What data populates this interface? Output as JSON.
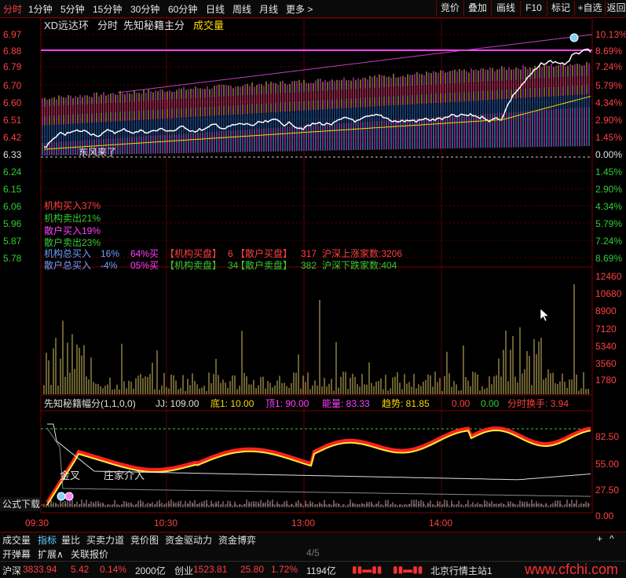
{
  "toolbar": {
    "periods": [
      "分时",
      "1分钟",
      "5分钟",
      "15分钟",
      "30分钟",
      "60分钟",
      "日线",
      "周线",
      "月线",
      "更多 >"
    ],
    "buttons": [
      "竞价",
      "叠加",
      "画线",
      "F10",
      "标记",
      "+自选",
      "返回"
    ]
  },
  "main_chart": {
    "title_stock": "XD远达环",
    "title_mode": "分时",
    "title_indicator": "先知秘籍主分",
    "title_volume": "成交量",
    "price_ticks": [
      "6.97",
      "6.88",
      "6.79",
      "6.70",
      "6.60",
      "6.51",
      "6.42",
      "6.33",
      "6.24",
      "6.15",
      "6.06",
      "5.96",
      "5.87",
      "5.78"
    ],
    "pct_ticks": [
      "10.13%",
      "8.69%",
      "7.24%",
      "5.79%",
      "4.34%",
      "2.90%",
      "1.45%",
      "0.00%",
      "1.45%",
      "2.90%",
      "4.34%",
      "5.79%",
      "7.24%",
      "8.69%"
    ],
    "inst_buy": "机构买入37%",
    "inst_sell": "机构卖出21%",
    "retail_buy": "散户买入19%",
    "retail_sell": "散户卖出23%",
    "row1_a": "机构总买入",
    "row1_b": "16%",
    "row1_c": "64%买",
    "row1_d": "【机构买盘】",
    "row1_e": "6",
    "row1_f": "【散户买盘】",
    "row1_g": "317",
    "row1_h": "沪深上涨家数:3206",
    "row2_a": "散户总买入",
    "row2_b": "-4%",
    "row2_c": "05%买",
    "row2_d": "【机构卖盘】",
    "row2_e": "34",
    "row2_f": "【散户卖盘】",
    "row2_g": "382",
    "row2_h": "沪深下跌家数:404",
    "marker_label": "东风来了"
  },
  "volume_chart": {
    "ticks": [
      "12460",
      "10680",
      "8900",
      "7120",
      "5340",
      "3560",
      "1780"
    ]
  },
  "indicator": {
    "name": "先知秘籍幅分(1,1,0,0)",
    "jj": "JJ: 109.00",
    "di": "底1: 10.00",
    "ding": "顶1: 90.00",
    "energy": "能量: 83.33",
    "trend": "趋势: 81.85",
    "v1": "0.00",
    "v2": "0.00",
    "turnover": "分时换手: 3.94",
    "ticks": [
      "82.50",
      "55.00",
      "27.50",
      "0.00"
    ],
    "label_jincha": "金叉",
    "label_zhuang": "庄家介入",
    "formula_btn": "公式下载"
  },
  "time_axis": [
    "09:30",
    "10:30",
    "13:00",
    "14:00"
  ],
  "bottom_tabs": [
    "成交量",
    "指标",
    "量比",
    "买卖力道",
    "竞价图",
    "资金驱动力",
    "资金博弈"
  ],
  "bottom_tabs2": [
    "开弹幕",
    "扩展∧",
    "关联报价"
  ],
  "pager": "4/5",
  "status": {
    "sh_name": "沪深",
    "sh_val": "3833.94",
    "sh_chg": "5.42",
    "sh_pct": "0.14%",
    "sh_amt": "2000亿",
    "cy_name": "创业",
    "cy_val": "1523.81",
    "cy_chg": "25.80",
    "cy_pct": "1.72%",
    "cy_amt": "1194亿",
    "station": "北京行情主站1",
    "watermark": "www.cfchi.com"
  },
  "colors": {
    "up": "#ff4040",
    "down": "#33cc33",
    "grid": "#7a0000",
    "bg": "#000000"
  }
}
